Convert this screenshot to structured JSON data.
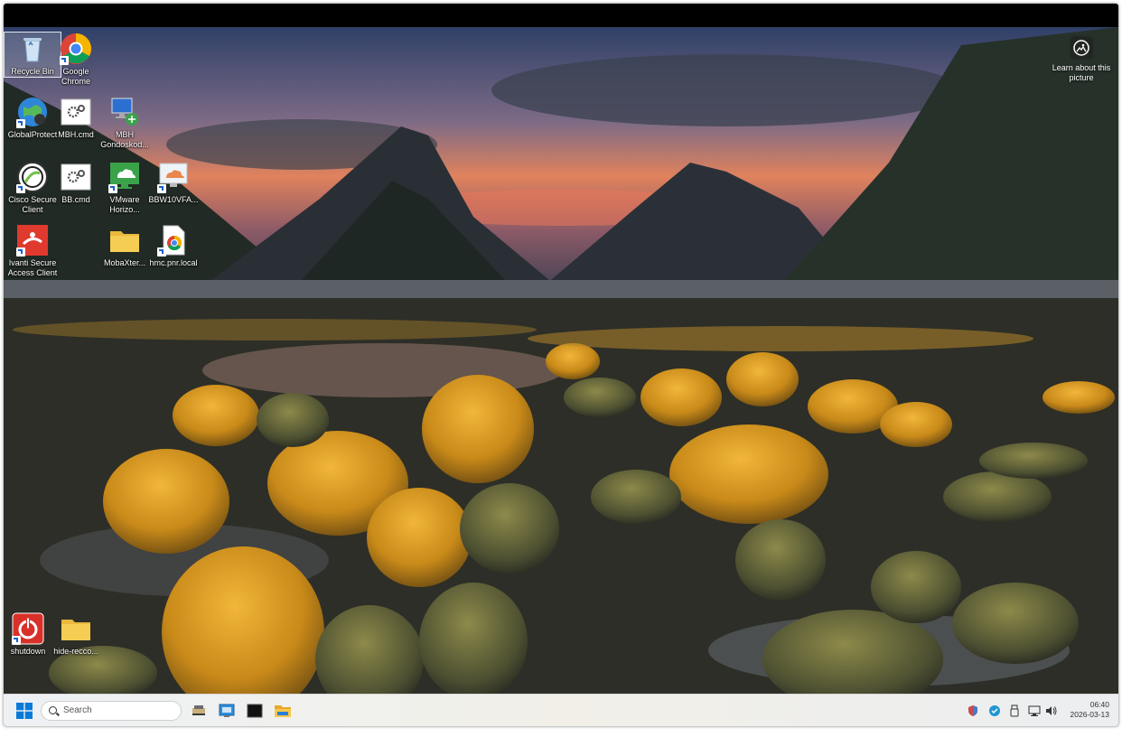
{
  "desktop": {
    "icons": [
      {
        "label": "Recycle Bin",
        "icon": "recycle-bin-icon"
      },
      {
        "label": "Google Chrome",
        "icon": "chrome-icon"
      },
      {
        "label": "GlobalProtect",
        "icon": "globe-icon"
      },
      {
        "label": "MBH.cmd",
        "icon": "gear-file-icon"
      },
      {
        "label": "MBH Gondoskod...",
        "icon": "computer-network-icon"
      },
      {
        "label": "Cisco Secure Client",
        "icon": "cisco-icon"
      },
      {
        "label": "BB.cmd",
        "icon": "gear-file-icon"
      },
      {
        "label": "VMware Horizo...",
        "icon": "vmware-horizon-icon"
      },
      {
        "label": "BBW10VFA...",
        "icon": "remote-desktop-icon"
      },
      {
        "label": "Ivanti Secure Access Client",
        "icon": "ivanti-icon"
      },
      {
        "label": "MobaXter...",
        "icon": "folder-icon"
      },
      {
        "label": "hmc.pnr.local",
        "icon": "chrome-file-icon"
      },
      {
        "label": "shutdown",
        "icon": "power-icon"
      },
      {
        "label": "hide-recco...",
        "icon": "folder-icon"
      }
    ],
    "learn_about": "Learn about this picture"
  },
  "taskbar": {
    "search_placeholder": "Search",
    "pinned": [
      {
        "name": "file-tool-icon"
      },
      {
        "name": "remote-desktop-icon"
      },
      {
        "name": "terminal-icon"
      },
      {
        "name": "file-explorer-icon"
      }
    ],
    "tray": [
      "shield-icon",
      "security-icon",
      "usb-icon",
      "network-icon",
      "volume-icon"
    ],
    "time": "06:40",
    "date": "2026-03-13"
  },
  "colors": {
    "taskbar_bg": "#eef1f4",
    "accent": "#0067c0"
  }
}
